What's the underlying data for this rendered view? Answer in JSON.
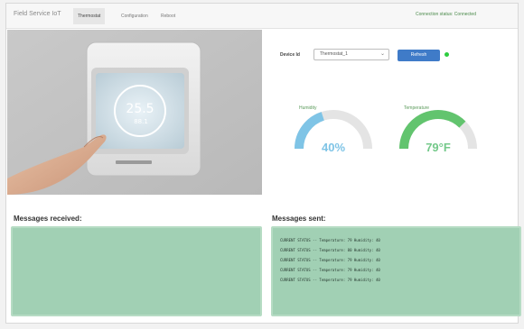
{
  "app": {
    "brand": "Field Service IoT"
  },
  "nav": {
    "tabs": [
      {
        "label": "Thermostat",
        "active": true
      },
      {
        "label": "Configuration",
        "active": false
      },
      {
        "label": "Reboot",
        "active": false
      }
    ],
    "connection_status": "Connection status: Connected"
  },
  "device": {
    "label": "Device Id",
    "selected": "Thermostat_1",
    "refresh_label": "Refresh",
    "status_color": "#2ecc40"
  },
  "gauges": {
    "humidity": {
      "label": "Humidity",
      "value_text": "40%",
      "fraction": 0.4,
      "color": "#7fc4e6"
    },
    "temperature": {
      "label": "Temperature",
      "value_text": "79°F",
      "fraction": 0.75,
      "color": "#62c46e"
    }
  },
  "messages": {
    "received_title": "Messages received:",
    "sent_title": "Messages sent:",
    "received": [],
    "sent": [
      "CURRENT STATUS -- Temperature: 79 Humidity: 40",
      "CURRENT STATUS -- Temperature: 80 Humidity: 40",
      "CURRENT STATUS -- Temperature: 79 Humidity: 40",
      "CURRENT STATUS -- Temperature: 79 Humidity: 40",
      "CURRENT STATUS -- Temperature: 79 Humidity: 40"
    ]
  }
}
